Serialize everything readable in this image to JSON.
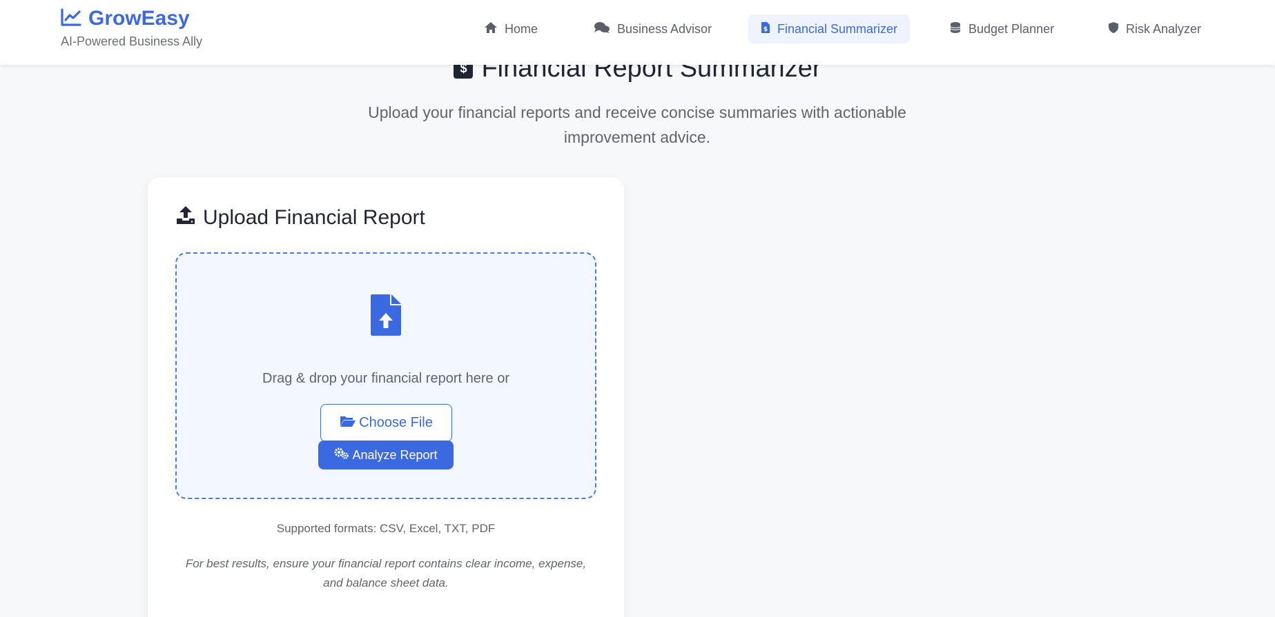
{
  "brand": {
    "name": "GrowEasy",
    "tagline": "AI-Powered Business Ally",
    "color": "#3b6ae0"
  },
  "nav": {
    "items": [
      {
        "label": "Home",
        "icon": "home-icon",
        "active": false
      },
      {
        "label": "Business Advisor",
        "icon": "comments-icon",
        "active": false
      },
      {
        "label": "Financial Summarizer",
        "icon": "file-invoice-dollar-icon",
        "active": true
      },
      {
        "label": "Budget Planner",
        "icon": "coins-icon",
        "active": false
      },
      {
        "label": "Risk Analyzer",
        "icon": "shield-icon",
        "active": false
      }
    ]
  },
  "page": {
    "title": "Financial Report Summarizer",
    "title_icon_glyph": "$",
    "subtitle": "Upload your financial reports and receive concise summaries with actionable improvement advice."
  },
  "upload": {
    "title": "Upload Financial Report",
    "drop_text": "Drag & drop your financial report here or",
    "choose_label": "Choose File",
    "analyze_label": "Analyze Report",
    "formats": "Supported formats: CSV, Excel, TXT, PDF",
    "note": "For best results, ensure your financial report contains clear income, expense, and balance sheet data."
  },
  "colors": {
    "accent": "#3b6ae0",
    "background": "#f7f8fa",
    "dropzone_bg": "#f3f7ff"
  }
}
